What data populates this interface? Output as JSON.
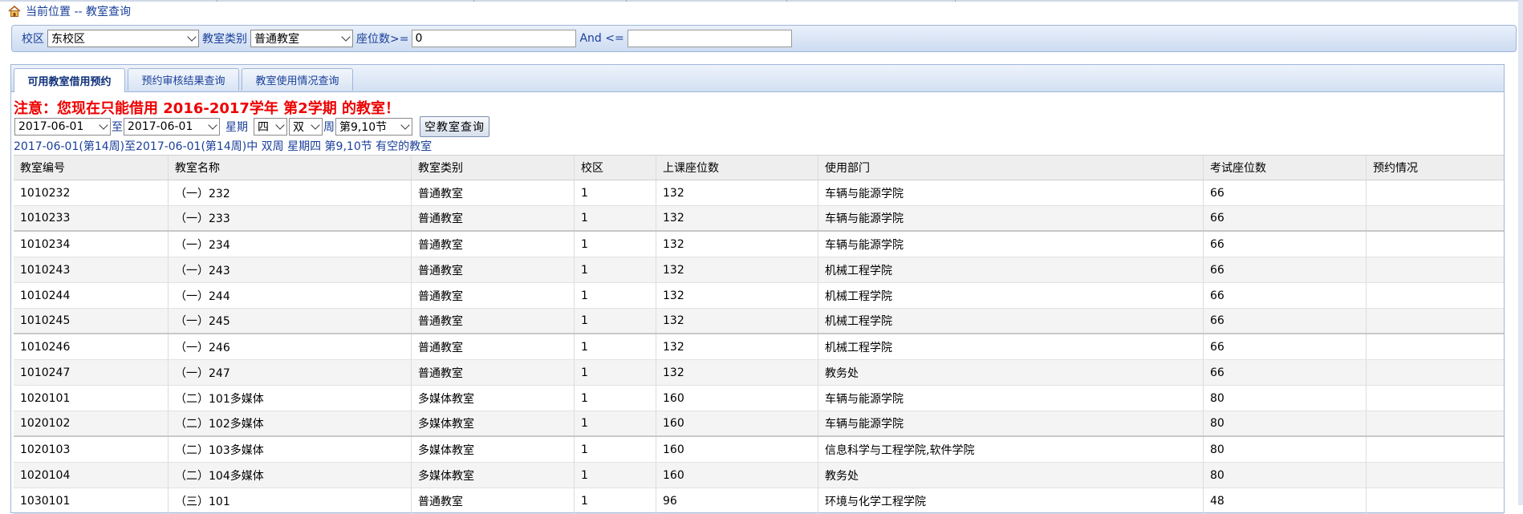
{
  "breadcrumb": {
    "label": "当前位置 -- 教室查询"
  },
  "filter": {
    "campus_label": "校区",
    "campus_value": "东校区",
    "type_label": "教室类别",
    "type_value": "普通教室",
    "seats_min_label": "座位数>=",
    "seats_min_value": "0",
    "and_label": "And <=",
    "seats_max_value": ""
  },
  "tabs": [
    {
      "label": "可用教室借用预约",
      "active": true
    },
    {
      "label": "预约审核结果查询",
      "active": false
    },
    {
      "label": "教室使用情况查询",
      "active": false
    }
  ],
  "notice": "注意：您现在只能借用 2016-2017学年 第2学期 的教室！",
  "query": {
    "date_from": "2017-06-01",
    "to_label": "至",
    "date_to": "2017-06-01",
    "weekday_label": "星期",
    "weekday_value": "四",
    "week_parity_value": "双",
    "week_label": "周",
    "period_value": "第9,10节",
    "search_button": "空教室查询"
  },
  "result_text": "2017-06-01(第14周)至2017-06-01(第14周)中 双周 星期四 第9,10节 有空的教室",
  "table": {
    "headers": [
      "教室编号",
      "教室名称",
      "教室类别",
      "校区",
      "上课座位数",
      "使用部门",
      "考试座位数",
      "预约情况"
    ],
    "rows": [
      [
        "1010232",
        "（一）232",
        "普通教室",
        "1",
        "132",
        "车辆与能源学院",
        "66",
        ""
      ],
      [
        "1010233",
        "（一）233",
        "普通教室",
        "1",
        "132",
        "车辆与能源学院",
        "66",
        ""
      ],
      [
        "1010234",
        "（一）234",
        "普通教室",
        "1",
        "132",
        "车辆与能源学院",
        "66",
        ""
      ],
      [
        "1010243",
        "（一）243",
        "普通教室",
        "1",
        "132",
        "机械工程学院",
        "66",
        ""
      ],
      [
        "1010244",
        "（一）244",
        "普通教室",
        "1",
        "132",
        "机械工程学院",
        "66",
        ""
      ],
      [
        "1010245",
        "（一）245",
        "普通教室",
        "1",
        "132",
        "机械工程学院",
        "66",
        ""
      ],
      [
        "1010246",
        "（一）246",
        "普通教室",
        "1",
        "132",
        "机械工程学院",
        "66",
        ""
      ],
      [
        "1010247",
        "（一）247",
        "普通教室",
        "1",
        "132",
        "教务处",
        "66",
        ""
      ],
      [
        "1020101",
        "（二）101多媒体",
        "多媒体教室",
        "1",
        "160",
        "车辆与能源学院",
        "80",
        ""
      ],
      [
        "1020102",
        "（二）102多媒体",
        "多媒体教室",
        "1",
        "160",
        "车辆与能源学院",
        "80",
        ""
      ],
      [
        "1020103",
        "（二）103多媒体",
        "多媒体教室",
        "1",
        "160",
        "信息科学与工程学院,软件学院",
        "80",
        ""
      ],
      [
        "1020104",
        "（二）104多媒体",
        "多媒体教室",
        "1",
        "160",
        "教务处",
        "80",
        ""
      ],
      [
        "1030101",
        "（三）101",
        "普通教室",
        "1",
        "96",
        "环境与化学工程学院",
        "48",
        ""
      ]
    ]
  },
  "colors": {
    "link_blue": "#1a3f9a",
    "notice_red": "#ee0000",
    "panel_border": "#9fb6d8"
  }
}
